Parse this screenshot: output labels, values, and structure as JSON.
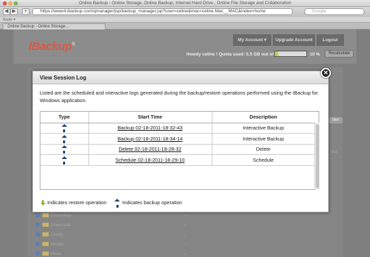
{
  "browser": {
    "window_title": "Online Backup - Online Storage, Online Backup, Internet Hard Drive , Online File Storage and Collaboration",
    "url": "https://www4.ibackup.com/qmanager/jsp/backup_manager.jsp?user=celine&mac=celine Mac__MAC&index=home",
    "search_placeholder": "Google",
    "bookmark_label": "Apple ▾",
    "tab_title": "Online Backup - Online Storage..."
  },
  "site": {
    "logo_text": "IBackup",
    "logo_mark": "®",
    "nav": {
      "my_account": "My Account ▾",
      "upgrade": "Upgrade Account",
      "logout": "Logout"
    },
    "quota_text": "Howdy celine ! Quota used: 5.5 GB out of 5.0 GB",
    "quota_percent": "10 %",
    "quota_fraction": 0.1,
    "recalculate": "Recalculate",
    "tiles_btn": "tiles",
    "click_text": "click",
    "bg_items": [
      "Documents",
      "Downloads",
      "Library",
      "Movies",
      "Music"
    ],
    "bg_dash": "--"
  },
  "modal": {
    "title": "View Session Log",
    "close_glyph": "✕",
    "intro": "Listed are the scheduled and interactive logs generated during the backup/restore operations performed using the IBackup for Windows application.",
    "columns": [
      "Type",
      "Start Time",
      "Description"
    ],
    "rows": [
      {
        "type": "backup",
        "start_time": "Backup 02-18-2011-18-32-43",
        "description": "Interactive Backup"
      },
      {
        "type": "backup",
        "start_time": "Backup 02-18-2011-18-34-14",
        "description": "Interactive Backup"
      },
      {
        "type": "backup",
        "start_time": "Delete 02-18-2011-18-28-32",
        "description": "Delete"
      },
      {
        "type": "backup",
        "start_time": "Schedule 02-18-2011-18-29-10",
        "description": "Schedule"
      }
    ],
    "legend": {
      "restore": "Indicates restore operation",
      "backup": "Indicates backup operation"
    },
    "colors": {
      "backup_arrow": "#1e3f7a",
      "restore_arrow": "#8bb83a"
    },
    "icons": {
      "backup": "arrow-up-icon",
      "restore": "arrow-down-icon"
    }
  }
}
